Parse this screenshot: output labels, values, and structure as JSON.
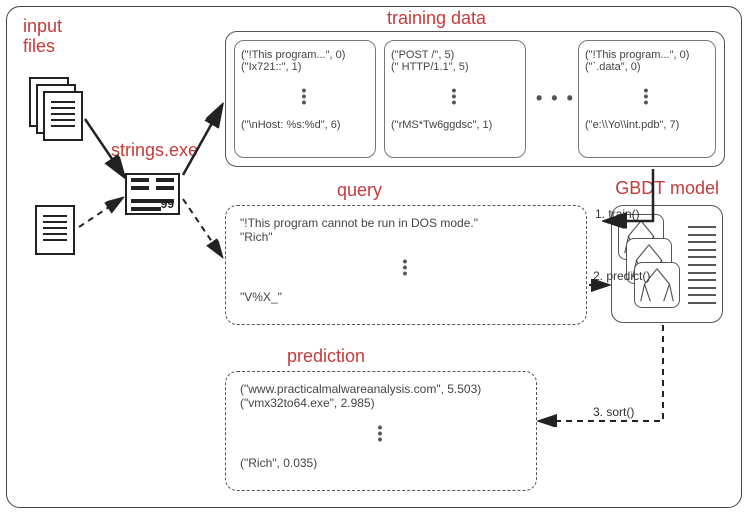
{
  "labels": {
    "input_files": "input\nfiles",
    "strings_exe": "strings.exe",
    "training_data": "training data",
    "query": "query",
    "prediction": "prediction",
    "gbdt_model": "GBDT model"
  },
  "steps": {
    "train": "1. train()",
    "predict": "2. predict()",
    "sort": "3. sort()"
  },
  "training_data": {
    "block1": {
      "r1": "(\"!This program...\", 0)",
      "r2": "(\"Ix721::\", 1)",
      "r3": "(\"\\nHost: %s:%d\", 6)"
    },
    "block2": {
      "r1": "(\"POST /\", 5)",
      "r2": "(\" HTTP/1.1\", 5)",
      "r3": "(\"rMS*Tw6ggdsc\", 1)"
    },
    "block3": {
      "r1": "(\"!This program...\", 0)",
      "r2": "(\"`.data\", 0)",
      "r3": "(\"e:\\\\Yo\\\\int.pdb\", 7)"
    }
  },
  "query": {
    "r1": "\"!This program cannot be run in DOS mode.\"",
    "r2": "\"Rich\"",
    "r3": "\"V%X_\""
  },
  "prediction": {
    "r1": "(\"www.practicalmalwareanalysis.com\", 5.503)",
    "r2": "(\"vmx32to64.exe\", 2.985)",
    "r3": "(\"Rich\", 0.035)"
  }
}
